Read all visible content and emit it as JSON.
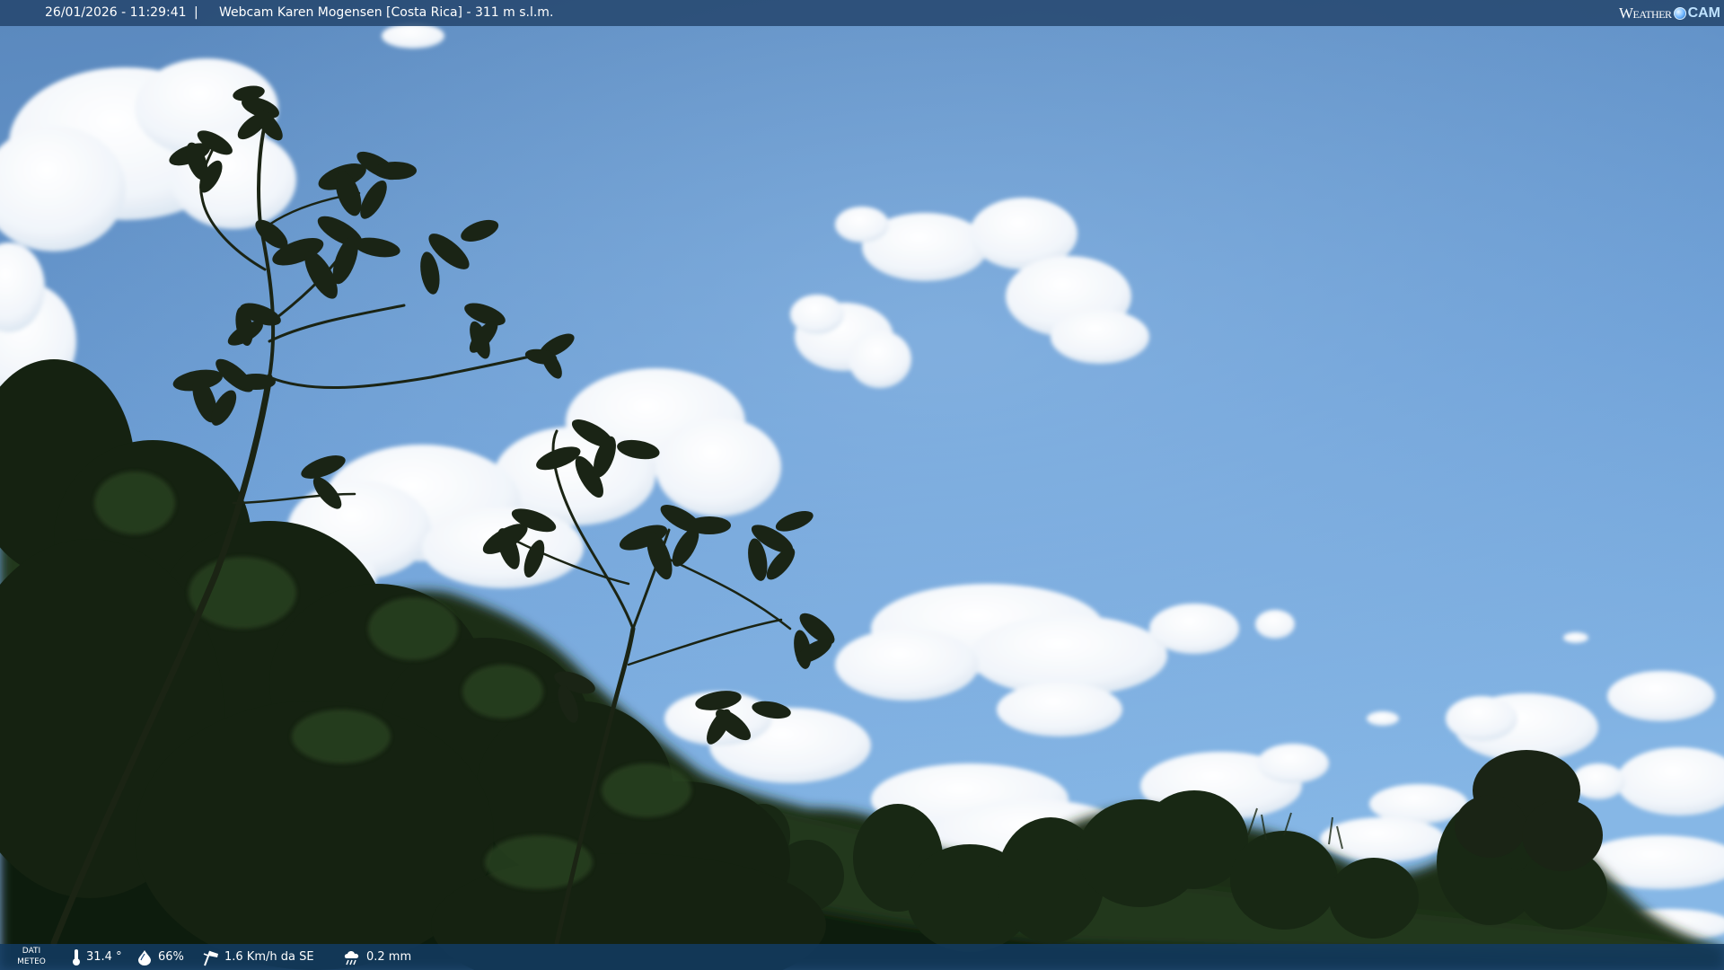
{
  "header": {
    "datetime": "26/01/2026 - 11:29:41",
    "separator": "|",
    "title": "Webcam Karen Mogensen [Costa Rica]  - 311 m s.l.m.",
    "logo": {
      "word1": "Weather",
      "word2": "CAM"
    }
  },
  "weather": {
    "label_line1": "DATI",
    "label_line2": "METEO",
    "temperature": "31.4 °",
    "humidity": "66%",
    "wind": "1.6 Km/h da SE",
    "rain": "0.2 mm",
    "icons": {
      "temperature": "thermometer-icon",
      "humidity": "humidity-drop-icon",
      "wind": "wind-sock-icon",
      "rain": "rain-cloud-icon"
    }
  },
  "colors": {
    "sky_top": "#5e8ec2",
    "sky_bottom": "#7eb0e3",
    "foliage_dark": "#13210f",
    "foliage_mid": "#26391c",
    "bar_blue": "#1f4d80"
  }
}
